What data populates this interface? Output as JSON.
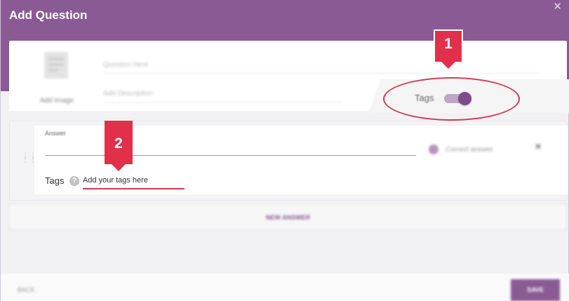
{
  "dialog": {
    "title": "Add Question",
    "close_icon": "close-icon"
  },
  "question": {
    "add_image_label": "Add Image",
    "question_placeholder": "Question Here",
    "description_placeholder": "Add Description",
    "tags_toggle_label": "Tags",
    "tags_toggle_on": true
  },
  "answer": {
    "field_label": "Answer",
    "correct_label": "Correct answer",
    "tags_label": "Tags",
    "help_icon_glyph": "?",
    "tags_placeholder": "Add your tags here"
  },
  "actions": {
    "new_answer_label": "NEW ANSWER",
    "back_label": "BACK",
    "save_label": "SAVE"
  },
  "callouts": [
    "1",
    "2"
  ],
  "colors": {
    "header": "#8a5a95",
    "accent": "#7e4c8c",
    "callout": "#e1304a",
    "highlight": "#d43a4f"
  }
}
